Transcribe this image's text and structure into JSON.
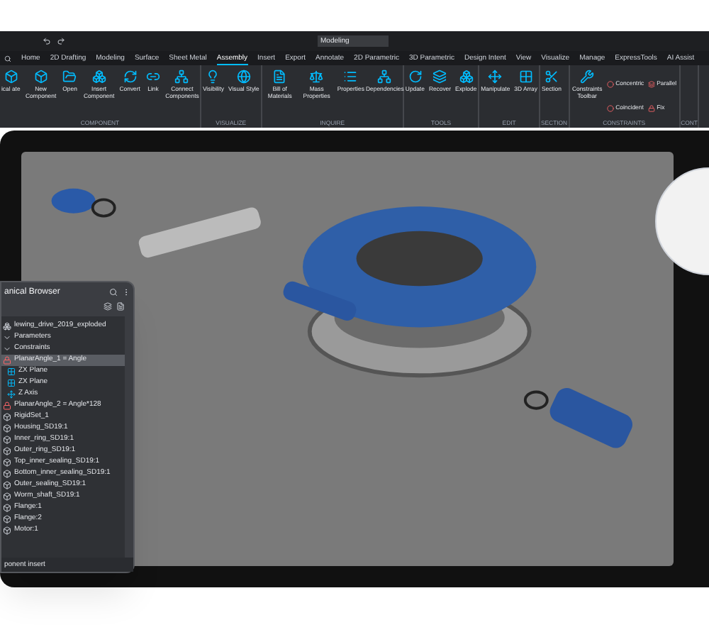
{
  "toolbar": {
    "workspace": "Modeling"
  },
  "tabs": [
    {
      "label": "Home",
      "selected": false
    },
    {
      "label": "2D Drafting",
      "selected": false
    },
    {
      "label": "Modeling",
      "selected": false
    },
    {
      "label": "Surface",
      "selected": false
    },
    {
      "label": "Sheet Metal",
      "selected": false
    },
    {
      "label": "Assembly",
      "selected": true
    },
    {
      "label": "Insert",
      "selected": false
    },
    {
      "label": "Export",
      "selected": false
    },
    {
      "label": "Annotate",
      "selected": false
    },
    {
      "label": "2D Parametric",
      "selected": false
    },
    {
      "label": "3D Parametric",
      "selected": false
    },
    {
      "label": "Design Intent",
      "selected": false
    },
    {
      "label": "View",
      "selected": false
    },
    {
      "label": "Visualize",
      "selected": false
    },
    {
      "label": "Manage",
      "selected": false
    },
    {
      "label": "ExpressTools",
      "selected": false
    },
    {
      "label": "AI Assist",
      "selected": false
    }
  ],
  "ribbon": [
    {
      "label": "COMPONENT",
      "buttons": [
        {
          "label": "ical ate",
          "kind": "large"
        },
        {
          "label": "New Component",
          "kind": "large"
        },
        {
          "label": "Open",
          "kind": "large"
        },
        {
          "label": "Insert Component",
          "kind": "large"
        },
        {
          "label": "Convert",
          "kind": "large"
        },
        {
          "label": "Link",
          "kind": "large"
        },
        {
          "label": "Connect Components",
          "kind": "large"
        }
      ]
    },
    {
      "label": "VISUALIZE",
      "buttons": [
        {
          "label": "Visibility",
          "kind": "large"
        },
        {
          "label": "Visual Style",
          "kind": "large"
        }
      ]
    },
    {
      "label": "INQUIRE",
      "buttons": [
        {
          "label": "Bill of Materials",
          "kind": "large"
        },
        {
          "label": "Mass Properties",
          "kind": "large"
        },
        {
          "label": "Properties",
          "kind": "large"
        },
        {
          "label": "Dependencies",
          "kind": "large"
        }
      ]
    },
    {
      "label": "TOOLS",
      "buttons": [
        {
          "label": "Update",
          "kind": "large"
        },
        {
          "label": "Recover",
          "kind": "large"
        },
        {
          "label": "Explode",
          "kind": "large"
        }
      ]
    },
    {
      "label": "EDIT",
      "buttons": [
        {
          "label": "Manipulate",
          "kind": "large"
        },
        {
          "label": "3D Array",
          "kind": "large"
        }
      ]
    },
    {
      "label": "SECTION",
      "buttons": [
        {
          "label": "Section",
          "kind": "large"
        }
      ]
    },
    {
      "label": "CONSTRAINTS",
      "buttons": [
        {
          "label": "Constraints Toolbar",
          "kind": "large"
        },
        {
          "label": "Concentric",
          "kind": "small"
        },
        {
          "label": "Coincident",
          "kind": "small"
        },
        {
          "label": "Parallel",
          "kind": "small"
        },
        {
          "label": "Fix",
          "kind": "small"
        }
      ]
    },
    {
      "label": "CONT"
    }
  ],
  "browser": {
    "title": "anical Browser",
    "footer": "ponent insert",
    "tree": [
      {
        "label": "lewing_drive_2019_exploded",
        "kind": "assembly",
        "selected": false,
        "children": [
          {
            "label": "Parameters",
            "kind": "folder",
            "selected": false
          },
          {
            "label": "Constraints",
            "kind": "folder",
            "selected": false
          },
          {
            "label": "PlanarAngle_1 = Angle",
            "kind": "constraint",
            "selected": true,
            "children": [
              {
                "label": "ZX Plane",
                "kind": "plane",
                "selected": false
              },
              {
                "label": "ZX Plane",
                "kind": "plane",
                "selected": false
              },
              {
                "label": "Z Axis",
                "kind": "axis",
                "selected": false
              }
            ]
          },
          {
            "label": "PlanarAngle_2 = Angle*128",
            "kind": "constraint",
            "selected": false
          },
          {
            "label": "RigidSet_1",
            "kind": "part",
            "selected": false
          },
          {
            "label": "Housing_SD19:1",
            "kind": "part",
            "selected": false
          },
          {
            "label": "Inner_ring_SD19:1",
            "kind": "part",
            "selected": false
          },
          {
            "label": "Outer_ring_SD19:1",
            "kind": "part",
            "selected": false
          },
          {
            "label": "Top_inner_sealing_SD19:1",
            "kind": "part",
            "selected": false
          },
          {
            "label": "Bottom_inner_sealing_SD19:1",
            "kind": "part",
            "selected": false
          },
          {
            "label": "Outer_sealing_SD19:1",
            "kind": "part",
            "selected": false
          },
          {
            "label": "Worm_shaft_SD19:1",
            "kind": "part",
            "selected": false
          },
          {
            "label": "Flange:1",
            "kind": "part",
            "selected": false
          },
          {
            "label": "Flange:2",
            "kind": "part",
            "selected": false
          },
          {
            "label": "Motor:1",
            "kind": "part",
            "selected": false
          }
        ]
      }
    ]
  }
}
